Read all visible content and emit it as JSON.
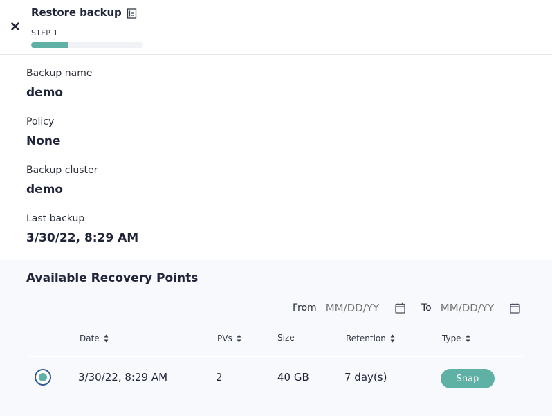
{
  "header": {
    "title": "Restore backup",
    "step_label": "STEP 1",
    "progress_fraction": 0.33
  },
  "details": [
    {
      "label": "Backup name",
      "value": "demo"
    },
    {
      "label": "Policy",
      "value": "None"
    },
    {
      "label": "Backup cluster",
      "value": "demo"
    },
    {
      "label": "Last backup",
      "value": "3/30/22, 8:29 AM"
    }
  ],
  "recovery": {
    "title": "Available Recovery Points",
    "from_label": "From",
    "from_placeholder": "MM/DD/YY",
    "to_label": "To",
    "to_placeholder": "MM/DD/YY",
    "columns": {
      "date": "Date",
      "pvs": "PVs",
      "size": "Size",
      "retention": "Retention",
      "type": "Type"
    },
    "rows": [
      {
        "selected": true,
        "date": "3/30/22, 8:29 AM",
        "pvs": "2",
        "size": "40 GB",
        "retention": "7 day(s)",
        "type": "Snap"
      }
    ]
  },
  "colors": {
    "accent": "#5fb1a5",
    "radio_border": "#2e5b94",
    "text": "#1f2438"
  }
}
